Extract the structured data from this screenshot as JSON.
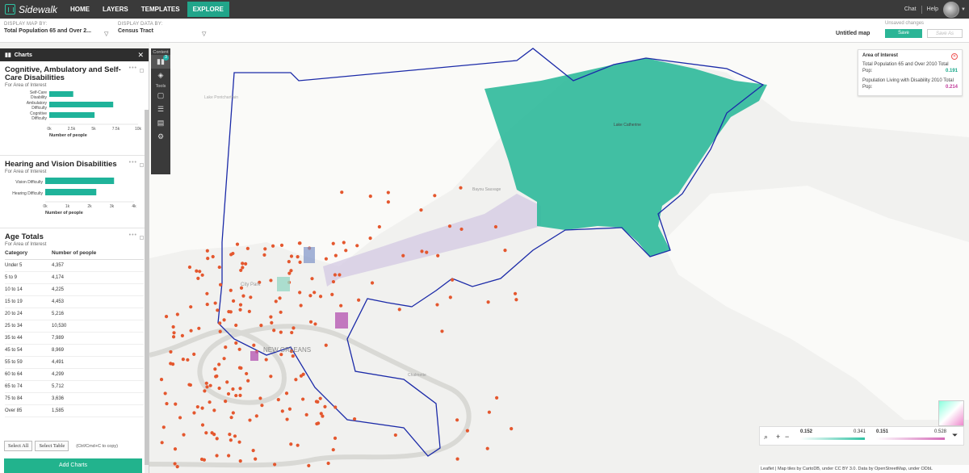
{
  "nav": {
    "logo": "Sidewalk",
    "logo_prefix": "",
    "items": [
      "HOME",
      "LAYERS",
      "TEMPLATES",
      "EXPLORE"
    ],
    "active": "EXPLORE",
    "chat": "Chat",
    "help": "Help"
  },
  "toolbar_top": {
    "display_map_by_label": "DISPLAY MAP BY:",
    "display_map_by_value": "Total Population 65 and Over 2...",
    "display_data_by_label": "DISPLAY DATA BY:",
    "display_data_by_value": "Census Tract",
    "map_title": "Untitled map",
    "unsaved": "Unsaved changes",
    "save": "Save",
    "save_as": "Save As"
  },
  "panel": {
    "title": "Charts",
    "charts": [
      {
        "title": "Cognitive, Ambulatory and Self-Care Disabilities",
        "subtitle": "For Area of Interest",
        "xlabel": "Number of people",
        "categories": [
          "Self-Care Disability",
          "Ambulatory Difficulty",
          "Cognitive Difficulty"
        ],
        "values": [
          2700,
          7200,
          5100
        ],
        "ticks": [
          "0k",
          "2.5k",
          "5k",
          "7.5k",
          "10k"
        ],
        "xmax": 10000
      },
      {
        "title": "Hearing and Vision Disabilities",
        "subtitle": "For Area of Interest",
        "xlabel": "Number of people",
        "categories": [
          "Vision Difficulty",
          "Hearing Difficulty"
        ],
        "values": [
          3100,
          2300
        ],
        "ticks": [
          "0k",
          "1k",
          "2k",
          "3k",
          "4k"
        ],
        "xmax": 4000
      }
    ],
    "age": {
      "title": "Age Totals",
      "subtitle": "For Area of Interest",
      "headers": [
        "Category",
        "Number of people"
      ],
      "rows": [
        [
          "Under 5",
          "4,357"
        ],
        [
          "5 to 9",
          "4,174"
        ],
        [
          "10 to 14",
          "4,225"
        ],
        [
          "15 to 19",
          "4,453"
        ],
        [
          "20 to 24",
          "5,216"
        ],
        [
          "25 to 34",
          "10,530"
        ],
        [
          "35 to 44",
          "7,989"
        ],
        [
          "45 to 54",
          "8,969"
        ],
        [
          "55 to 59",
          "4,491"
        ],
        [
          "60 to 64",
          "4,299"
        ],
        [
          "65 to 74",
          "5,712"
        ],
        [
          "75 to 84",
          "3,636"
        ],
        [
          "Over 85",
          "1,585"
        ]
      ]
    },
    "select_all": "Select All",
    "select_table": "Select Table",
    "copy_hint": "(Ctrl/Cmd+C to copy)",
    "add_charts": "Add Charts"
  },
  "side_tools": {
    "content_label": "Content",
    "tools_label": "Tools",
    "badge": "3"
  },
  "aoi": {
    "title": "Area of Interest",
    "line1": "Total Population 65 and Over 2010 Total Pop:",
    "value1": "0.191",
    "line2": "Population Living with Disability 2010 Total Pop:",
    "value2": "0.214",
    "color1": "#1aa88a",
    "color2": "#c23a9a"
  },
  "legend": {
    "v1": "0.152",
    "v2": "0.341",
    "v3": "0.151",
    "v4": "0.528"
  },
  "map_labels": {
    "city": "NEW ORLEANS",
    "lake": "Lake Pontchartrain",
    "city_park": "City Park",
    "lake_catherine": "Lake Catherine",
    "bayou_sauvage": "Bayou Sauvage",
    "chalmette": "Chalmette"
  },
  "attribution": "Leaflet | Map tiles by CartoDB, under CC BY 3.0. Data by OpenStreetMap, under ODbL"
}
